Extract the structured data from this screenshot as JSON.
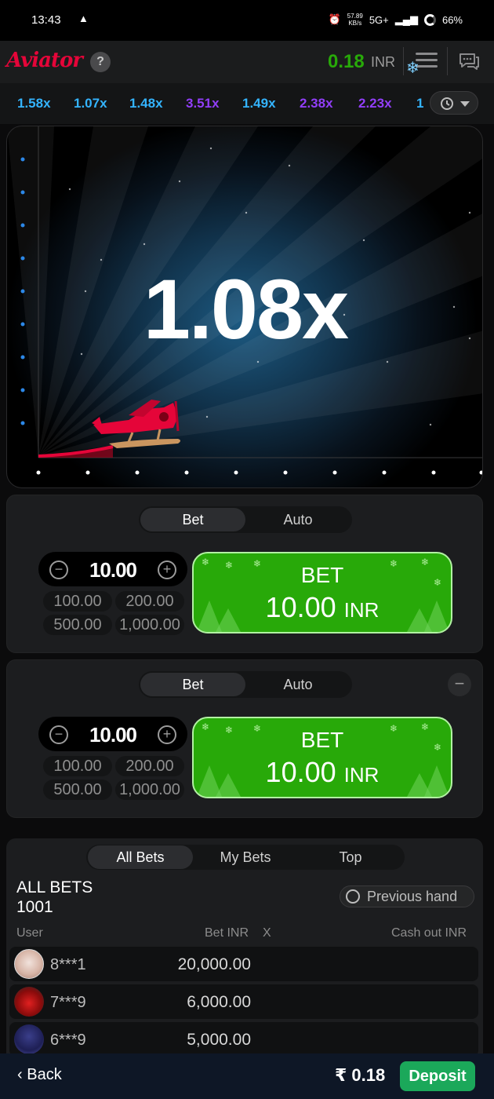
{
  "status_bar": {
    "time": "13:43",
    "alert_icon": "warning-triangle-icon",
    "network_speed_value": "57.89",
    "network_speed_unit": "KB/s",
    "network_type": "5G+",
    "battery": "66%"
  },
  "header": {
    "logo_text": "Aviator",
    "help_label": "?",
    "balance_value": "0.18",
    "balance_currency": "INR",
    "snow_badge": "❄"
  },
  "multipliers": [
    {
      "value": "1.58x",
      "color": "#34b4ff"
    },
    {
      "value": "1.07x",
      "color": "#34b4ff"
    },
    {
      "value": "1.48x",
      "color": "#34b4ff"
    },
    {
      "value": "3.51x",
      "color": "#913ef8"
    },
    {
      "value": "1.49x",
      "color": "#34b4ff"
    },
    {
      "value": "2.38x",
      "color": "#913ef8"
    },
    {
      "value": "2.23x",
      "color": "#913ef8"
    },
    {
      "value": "1",
      "color": "#34b4ff"
    }
  ],
  "game": {
    "current_multiplier": "1.08x"
  },
  "bet_panels": [
    {
      "tab_bet": "Bet",
      "tab_auto": "Auto",
      "amount": "10.00",
      "minus_label": "−",
      "plus_label": "+",
      "quick": [
        "100.00",
        "200.00",
        "500.00",
        "1,000.00"
      ],
      "button_line1": "BET",
      "button_amount": "10.00",
      "button_currency": "INR"
    },
    {
      "tab_bet": "Bet",
      "tab_auto": "Auto",
      "remove_label": "−",
      "amount": "10.00",
      "minus_label": "−",
      "plus_label": "+",
      "quick": [
        "100.00",
        "200.00",
        "500.00",
        "1,000.00"
      ],
      "button_line1": "BET",
      "button_amount": "10.00",
      "button_currency": "INR"
    }
  ],
  "bets": {
    "tabs": [
      "All Bets",
      "My Bets",
      "Top"
    ],
    "title": "ALL BETS",
    "count": "1001",
    "previous_hand": "Previous hand",
    "columns": {
      "user": "User",
      "bet": "Bet INR",
      "x": "X",
      "cashout": "Cash out INR"
    },
    "rows": [
      {
        "user": "8***1",
        "bet": "20,000.00"
      },
      {
        "user": "7***9",
        "bet": "6,000.00"
      },
      {
        "user": "6***9",
        "bet": "5,000.00"
      }
    ]
  },
  "bottom_bar": {
    "back_label": "Back",
    "balance": "₹ 0.18",
    "deposit_label": "Deposit"
  }
}
